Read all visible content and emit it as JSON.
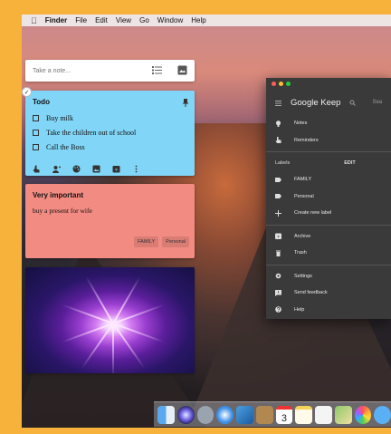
{
  "menubar": {
    "apple": "",
    "items": [
      "Finder",
      "File",
      "Edit",
      "View",
      "Go",
      "Window",
      "Help"
    ]
  },
  "note_input": {
    "placeholder": "Take a note..."
  },
  "todo": {
    "title": "Todo",
    "items": [
      "Buy milk",
      "Take the children out of school",
      "Call the Boss"
    ]
  },
  "important": {
    "title": "Very important",
    "body": "buy a present for wife",
    "labels": [
      "FAMILY",
      "Personal"
    ]
  },
  "keep_window": {
    "brand": "Google Keep",
    "search": "Sea",
    "nav": [
      {
        "label": "Notes",
        "icon": "bulb-icon"
      },
      {
        "label": "Reminders",
        "icon": "hand-icon"
      }
    ],
    "labels_header": "Labels",
    "edit": "EDIT",
    "labels": [
      {
        "label": "FAMILY",
        "icon": "label-icon"
      },
      {
        "label": "Personal",
        "icon": "label-icon"
      },
      {
        "label": "Create new label",
        "icon": "plus-icon"
      }
    ],
    "more": [
      {
        "label": "Archive",
        "icon": "archive-icon"
      },
      {
        "label": "Trash",
        "icon": "trash-icon"
      }
    ],
    "footer": [
      {
        "label": "Settings",
        "icon": "gear-icon"
      },
      {
        "label": "Send feedback",
        "icon": "feedback-icon"
      },
      {
        "label": "Help",
        "icon": "help-icon"
      }
    ]
  },
  "dock": {
    "calendar_day": "3",
    "apps": [
      "finder",
      "siri",
      "launchpad",
      "safari",
      "photo",
      "contacts",
      "calendar",
      "notes",
      "reminders",
      "maps",
      "photos",
      "messages"
    ]
  },
  "colors": {
    "todo_bg": "#81d6f7",
    "important_bg": "#f28b82",
    "keep_bg": "#3a3a3a",
    "desktop_border": "#f7b23b"
  }
}
